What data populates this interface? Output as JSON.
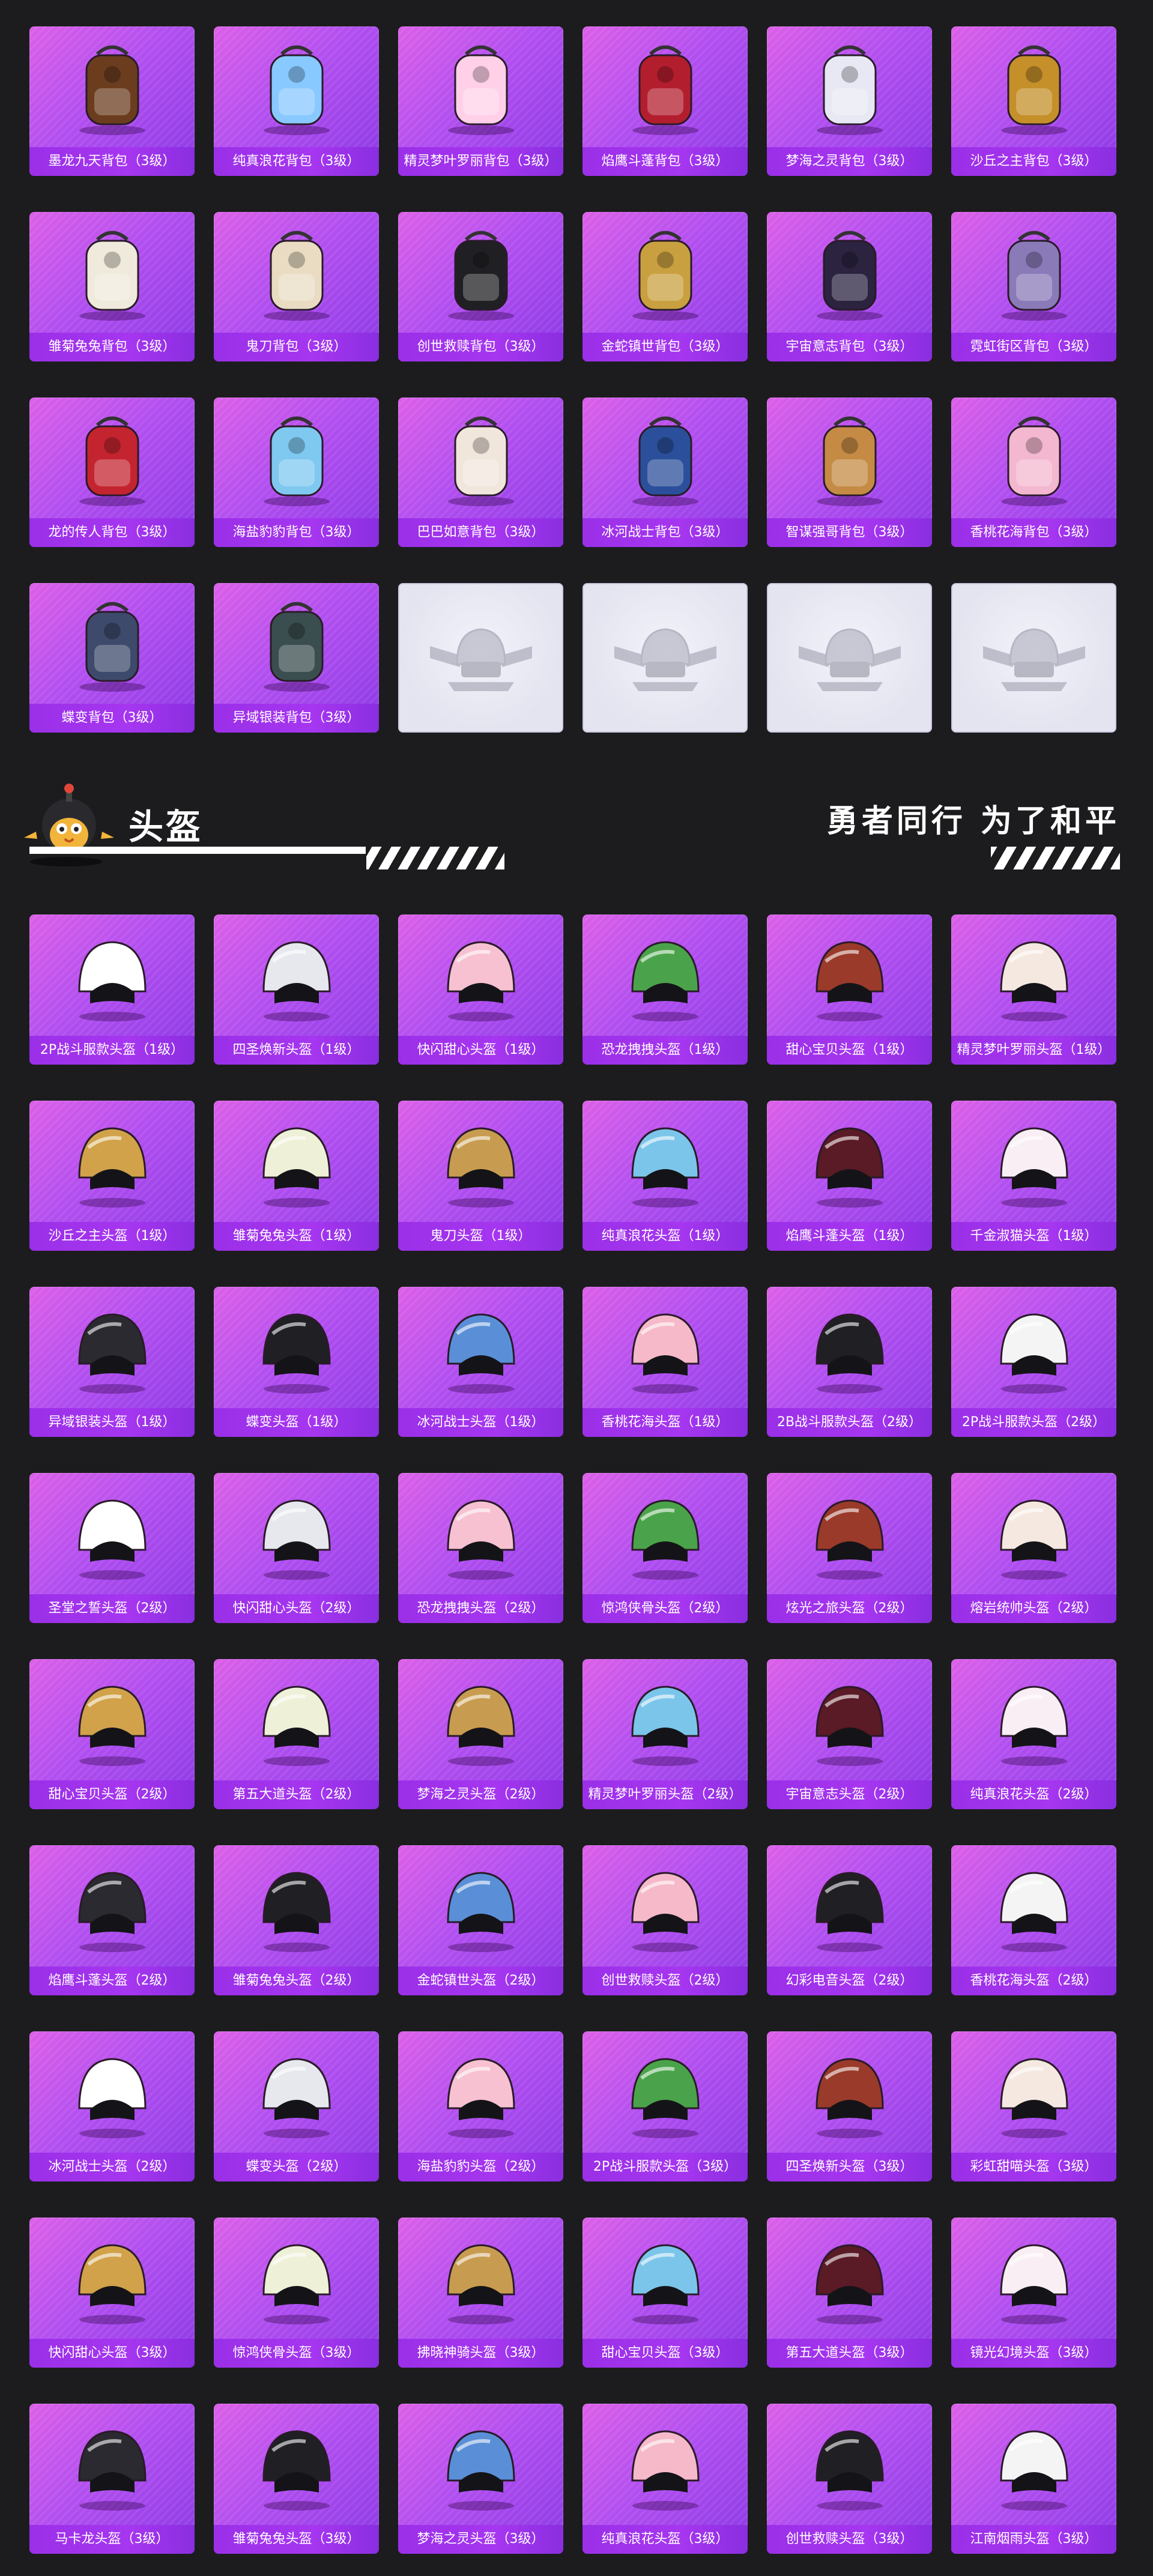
{
  "backpacks": [
    {
      "label": "墨龙九天背包（3级）",
      "icon": "dragon-backpack-icon"
    },
    {
      "label": "纯真浪花背包（3级）",
      "icon": "wave-backpack-icon"
    },
    {
      "label": "精灵梦叶罗丽背包（3级）",
      "icon": "fairy-backpack-icon"
    },
    {
      "label": "焰鹰斗蓬背包（3级）",
      "icon": "eagle-backpack-icon"
    },
    {
      "label": "梦海之灵背包（3级）",
      "icon": "seaspirit-backpack-icon"
    },
    {
      "label": "沙丘之主背包（3级）",
      "icon": "dune-backpack-icon"
    },
    {
      "label": "雏菊兔兔背包（3级）",
      "icon": "bunny-backpack-icon"
    },
    {
      "label": "鬼刀背包（3级）",
      "icon": "ghostblade-backpack-icon"
    },
    {
      "label": "创世救赎背包（3级）",
      "icon": "genesis-backpack-icon"
    },
    {
      "label": "金蛇镇世背包（3级）",
      "icon": "goldsnake-backpack-icon"
    },
    {
      "label": "宇宙意志背包（3级）",
      "icon": "cosmic-backpack-icon"
    },
    {
      "label": "霓虹街区背包（3级）",
      "icon": "neon-backpack-icon"
    },
    {
      "label": "龙的传人背包（3级）",
      "icon": "dragonheir-backpack-icon"
    },
    {
      "label": "海盐豹豹背包（3级）",
      "icon": "leopard-backpack-icon"
    },
    {
      "label": "巴巴如意背包（3级）",
      "icon": "ruyi-backpack-icon"
    },
    {
      "label": "冰河战士背包（3级）",
      "icon": "glacier-backpack-icon"
    },
    {
      "label": "智谋强哥背包（3级）",
      "icon": "strategist-backpack-icon"
    },
    {
      "label": "香桃花海背包（3级）",
      "icon": "peach-backpack-icon"
    },
    {
      "label": "蝶变背包（3级）",
      "icon": "butterfly-backpack-icon"
    },
    {
      "label": "异域银装背包（3级）",
      "icon": "exotic-backpack-icon"
    },
    {
      "label": "",
      "icon": "placeholder-emblem-icon"
    },
    {
      "label": "",
      "icon": "placeholder-emblem-icon"
    },
    {
      "label": "",
      "icon": "placeholder-emblem-icon"
    },
    {
      "label": "",
      "icon": "placeholder-emblem-icon"
    }
  ],
  "section": {
    "title": "头盔",
    "tagline": "勇者同行 为了和平"
  },
  "helmets": [
    {
      "label": "2P战斗服款头盔（1级）"
    },
    {
      "label": "四圣焕新头盔（1级）"
    },
    {
      "label": "快闪甜心头盔（1级）"
    },
    {
      "label": "恐龙拽拽头盔（1级）"
    },
    {
      "label": "甜心宝贝头盔（1级）"
    },
    {
      "label": "精灵梦叶罗丽头盔（1级）"
    },
    {
      "label": "沙丘之主头盔（1级）"
    },
    {
      "label": "雏菊兔兔头盔（1级）"
    },
    {
      "label": "鬼刀头盔（1级）"
    },
    {
      "label": "纯真浪花头盔（1级）"
    },
    {
      "label": "焰鹰斗蓬头盔（1级）"
    },
    {
      "label": "千金淑猫头盔（1级）"
    },
    {
      "label": "异域银装头盔（1级）"
    },
    {
      "label": "蝶变头盔（1级）"
    },
    {
      "label": "冰河战士头盔（1级）"
    },
    {
      "label": "香桃花海头盔（1级）"
    },
    {
      "label": "2B战斗服款头盔（2级）"
    },
    {
      "label": "2P战斗服款头盔（2级）"
    },
    {
      "label": "圣堂之誓头盔（2级）"
    },
    {
      "label": "快闪甜心头盔（2级）"
    },
    {
      "label": "恐龙拽拽头盔（2级）"
    },
    {
      "label": "惊鸿侠骨头盔（2级）"
    },
    {
      "label": "炫光之旅头盔（2级）"
    },
    {
      "label": "熔岩统帅头盔（2级）"
    },
    {
      "label": "甜心宝贝头盔（2级）"
    },
    {
      "label": "第五大道头盔（2级）"
    },
    {
      "label": "梦海之灵头盔（2级）"
    },
    {
      "label": "精灵梦叶罗丽头盔（2级）"
    },
    {
      "label": "宇宙意志头盔（2级）"
    },
    {
      "label": "纯真浪花头盔（2级）"
    },
    {
      "label": "焰鹰斗蓬头盔（2级）"
    },
    {
      "label": "雏菊兔兔头盔（2级）"
    },
    {
      "label": "金蛇镇世头盔（2级）"
    },
    {
      "label": "创世救赎头盔（2级）"
    },
    {
      "label": "幻彩电音头盔（2级）"
    },
    {
      "label": "香桃花海头盔（2级）"
    },
    {
      "label": "冰河战士头盔（2级）"
    },
    {
      "label": "蝶变头盔（2级）"
    },
    {
      "label": "海盐豹豹头盔（2级）"
    },
    {
      "label": "2P战斗服款头盔（3级）"
    },
    {
      "label": "四圣焕新头盔（3级）"
    },
    {
      "label": "彩虹甜喵头盔（3级）"
    },
    {
      "label": "快闪甜心头盔（3级）"
    },
    {
      "label": "惊鸿侠骨头盔（3级）"
    },
    {
      "label": "拂晓神骑头盔（3级）"
    },
    {
      "label": "甜心宝贝头盔（3级）"
    },
    {
      "label": "第五大道头盔（3级）"
    },
    {
      "label": "镜光幻境头盔（3级）"
    },
    {
      "label": "马卡龙头盔（3级）"
    },
    {
      "label": "雏菊兔兔头盔（3级）"
    },
    {
      "label": "梦海之灵头盔（3级）"
    },
    {
      "label": "纯真浪花头盔（3级）"
    },
    {
      "label": "创世救赎头盔（3级）"
    },
    {
      "label": "江南烟雨头盔（3级）"
    }
  ],
  "colors": {
    "background": "#1c1c1e",
    "card_gradient_start": "#dc5fe8",
    "card_gradient_end": "#8c3ae6",
    "label_bar": "#a636f0",
    "empty_card": "#e4e4f0"
  }
}
